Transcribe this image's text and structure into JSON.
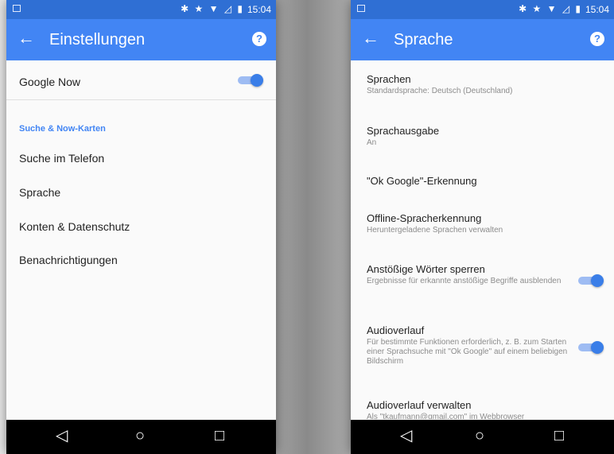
{
  "left_screen": {
    "status": {
      "icons": "✱ ★ ▼ ◿ ▮",
      "time": "15:04"
    },
    "title": "Einstellungen",
    "back_glyph": "←",
    "help_glyph": "?",
    "google_now": {
      "label": "Google Now",
      "enabled": true
    },
    "section_header": "Suche & Now-Karten",
    "items": [
      "Suche im Telefon",
      "Sprache",
      "Konten & Datenschutz",
      "Benachrichtigungen"
    ],
    "nav": {
      "back": "◁",
      "home": "○",
      "recents": "□"
    }
  },
  "right_screen": {
    "status": {
      "icons": "✱ ★ ▼ ◿ ▮",
      "time": "15:04"
    },
    "title": "Sprache",
    "back_glyph": "←",
    "help_glyph": "?",
    "prefs": [
      {
        "title": "Sprachen",
        "summary": "Standardsprache: Deutsch (Deutschland)"
      },
      {
        "title": "Sprachausgabe",
        "summary": "An"
      },
      {
        "title": "\"Ok Google\"-Erkennung",
        "summary": ""
      },
      {
        "title": "Offline-Spracherkennung",
        "summary": "Heruntergeladene Sprachen verwalten"
      },
      {
        "title": "Anstößige Wörter sperren",
        "summary": "Ergebnisse für erkannte anstößige Begriffe ausblenden",
        "enabled": true
      },
      {
        "title": "Audioverlauf",
        "summary": "Für bestimmte Funktionen erforderlich, z. B. zum Starten einer Sprachsuche mit \"Ok Google\" auf einem beliebigen Bildschirm",
        "enabled": true
      },
      {
        "title": "Audioverlauf verwalten",
        "summary": "Als \"tkaufmann@gmail.com\" im Webbrowser"
      }
    ],
    "nav": {
      "back": "◁",
      "home": "○",
      "recents": "□"
    }
  },
  "colors": {
    "appbar": "#4285f4",
    "statusbar": "#2f6fd4",
    "accent": "#4285f4",
    "navbar": "#000000"
  }
}
